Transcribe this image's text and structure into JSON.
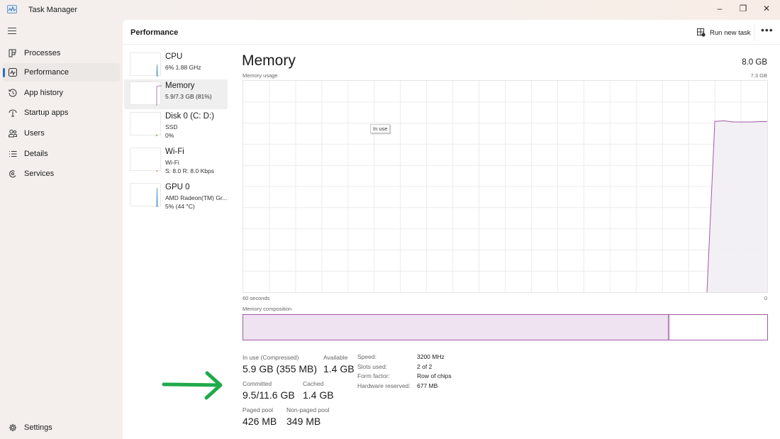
{
  "window": {
    "title": "Task Manager",
    "controls": {
      "minimize": "–",
      "maximize": "❐",
      "close": "✕"
    }
  },
  "sidebar": {
    "menu_icon": "hamburger-icon",
    "items": [
      {
        "label": "Processes",
        "icon": "processes-icon",
        "active": false
      },
      {
        "label": "Performance",
        "icon": "performance-icon",
        "active": true
      },
      {
        "label": "App history",
        "icon": "history-icon",
        "active": false
      },
      {
        "label": "Startup apps",
        "icon": "startup-icon",
        "active": false
      },
      {
        "label": "Users",
        "icon": "users-icon",
        "active": false
      },
      {
        "label": "Details",
        "icon": "details-icon",
        "active": false
      },
      {
        "label": "Services",
        "icon": "services-icon",
        "active": false
      }
    ],
    "settings": {
      "label": "Settings",
      "icon": "gear-icon"
    }
  },
  "header": {
    "title": "Performance",
    "run_new_task": "Run new task",
    "more": "•••"
  },
  "tiles": [
    {
      "name": "CPU",
      "lines": [
        "6%  1.88 GHz"
      ],
      "color": "#4a90c8",
      "active": false
    },
    {
      "name": "Memory",
      "lines": [
        "5.9/7.3 GB (81%)"
      ],
      "color": "#a05aa6",
      "active": true
    },
    {
      "name": "Disk 0 (C: D:)",
      "lines": [
        "SSD",
        "0%"
      ],
      "color": "#6aa84f",
      "active": false
    },
    {
      "name": "Wi-Fi",
      "lines": [
        "Wi-Fi",
        "S: 8.0  R: 8.0 Kbps"
      ],
      "color": "#c67b30",
      "active": false
    },
    {
      "name": "GPU 0",
      "lines": [
        "AMD Radeon(TM) Gr...",
        "5%  (44 °C)"
      ],
      "color": "#4a90c8",
      "active": false
    }
  ],
  "detail": {
    "title": "Memory",
    "total": "8.0 GB",
    "usage_label": "Memory usage",
    "usage_max": "7.3 GB",
    "tooltip": "In use",
    "axis_left": "60 seconds",
    "axis_right": "0",
    "composition_label": "Memory composition",
    "composition": {
      "in_use_fraction": 0.81,
      "modified_fraction": 0.004,
      "colors": {
        "in_use": "#efe3f1",
        "modified": "#dcc6df",
        "border": "#a05aa6"
      }
    },
    "stats": {
      "in_use": {
        "label": "In use (Compressed)",
        "value": "5.9 GB (355 MB)"
      },
      "available": {
        "label": "Available",
        "value": "1.4 GB"
      },
      "committed": {
        "label": "Committed",
        "value": "9.5/11.6 GB"
      },
      "cached": {
        "label": "Cached",
        "value": "1.4 GB"
      },
      "paged_pool": {
        "label": "Paged pool",
        "value": "426 MB"
      },
      "non_paged_pool": {
        "label": "Non-paged pool",
        "value": "349 MB"
      }
    },
    "specs": [
      {
        "key": "Speed:",
        "value": "3200 MHz"
      },
      {
        "key": "Slots used:",
        "value": "2 of 2"
      },
      {
        "key": "Form factor:",
        "value": "Row of chips"
      },
      {
        "key": "Hardware reserved:",
        "value": "677 MB"
      }
    ]
  },
  "chart_data": {
    "type": "area",
    "title": "Memory usage",
    "xlabel": "60 seconds",
    "ylabel": "",
    "x_range_seconds": [
      60,
      0
    ],
    "ylim_gb": [
      0,
      7.3
    ],
    "grid": true,
    "series": [
      {
        "name": "In use",
        "color": "#a05aa6",
        "fill": "#f1edf3",
        "points_seconds_ago_gb": [
          [
            60,
            null
          ],
          [
            7,
            null
          ],
          [
            6.9,
            0
          ],
          [
            6.0,
            5.9
          ],
          [
            4.9,
            5.92
          ],
          [
            3.9,
            5.88
          ],
          [
            2.9,
            5.88
          ],
          [
            1.9,
            5.88
          ],
          [
            0.9,
            5.89
          ],
          [
            0,
            5.89
          ]
        ]
      }
    ]
  },
  "annotation": {
    "type": "arrow",
    "color": "#1faa4a",
    "points_to": "Committed"
  }
}
